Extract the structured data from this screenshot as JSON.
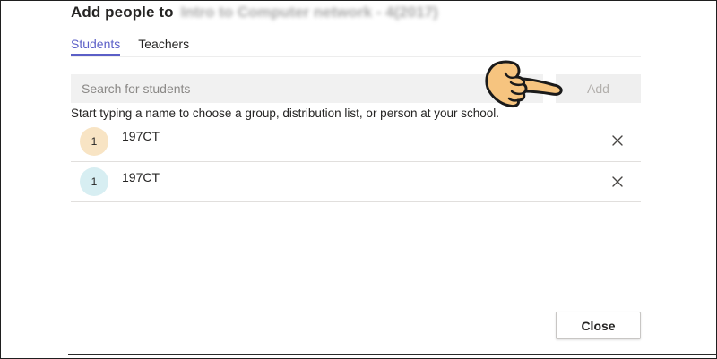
{
  "dialog": {
    "title": "Add people to",
    "team_name_blurred": "Intro to Computer network - 4(2017)"
  },
  "tabs": [
    {
      "label": "Students",
      "active": true
    },
    {
      "label": "Teachers",
      "active": false
    }
  ],
  "search": {
    "placeholder": "Search for students",
    "value": ""
  },
  "add_button": {
    "label": "Add",
    "enabled": false
  },
  "hint_text": "Start typing a name to choose a group, distribution list, or person at your school.",
  "selected": [
    {
      "avatar_text": "1",
      "name": "197CT",
      "avatar_color": "#f8e4c4",
      "icon": "close-icon"
    },
    {
      "avatar_text": "1",
      "name": "197CT",
      "avatar_color": "#d7eef2",
      "icon": "close-icon"
    }
  ],
  "close_button": {
    "label": "Close"
  },
  "colors": {
    "accent": "#5b5fc7",
    "hand_fill": "#f6c47f"
  },
  "pointer_icon": "pointing-hand-icon"
}
